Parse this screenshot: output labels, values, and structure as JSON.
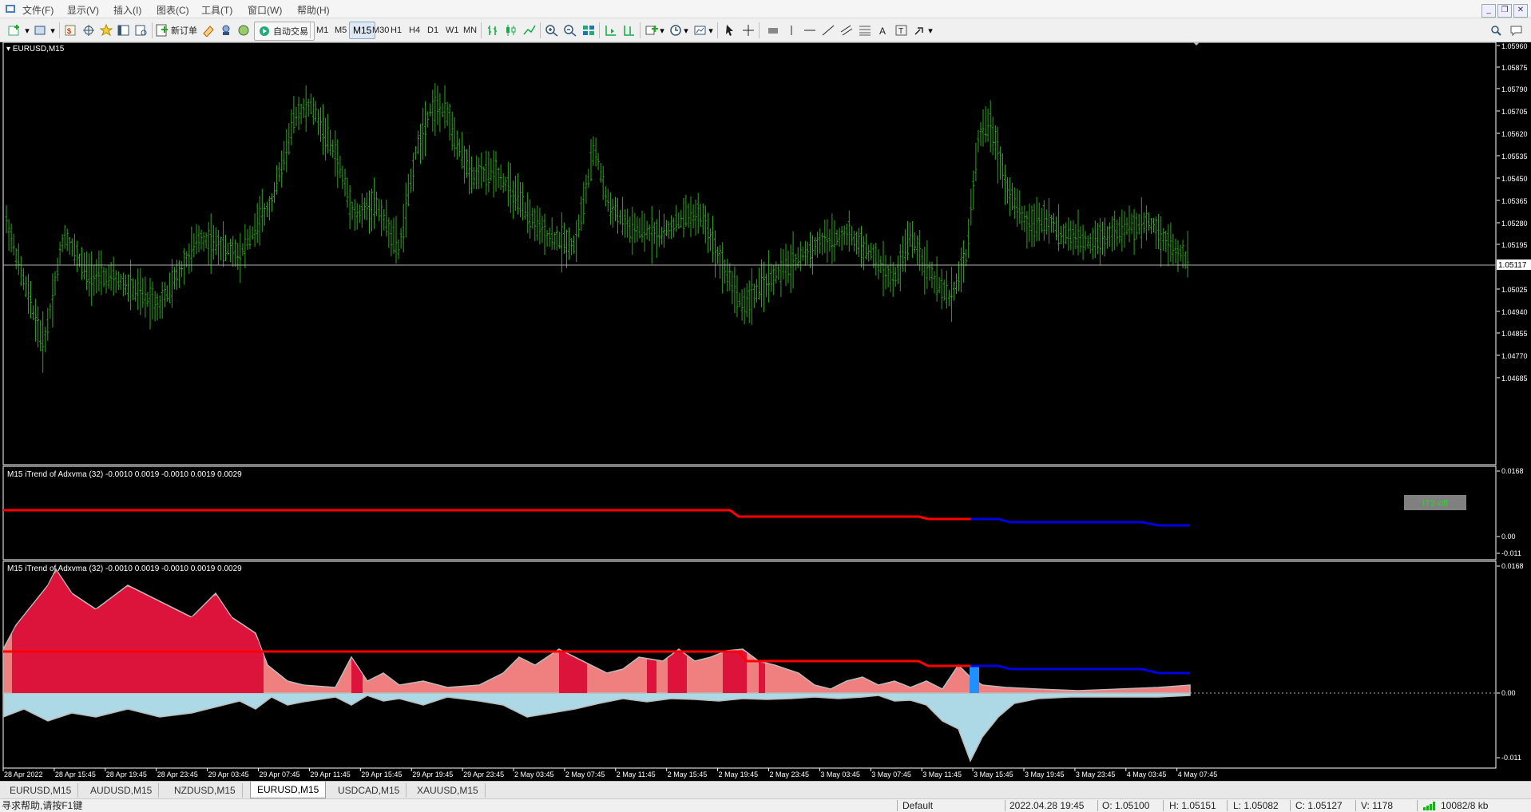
{
  "menu": [
    "文件(F)",
    "显示(V)",
    "插入(I)",
    "图表(C)",
    "工具(T)",
    "窗口(W)",
    "帮助(H)"
  ],
  "toolbar": {
    "new_order": "新订单",
    "auto_trading": "自动交易",
    "timeframes": [
      "M1",
      "M5",
      "M15",
      "M30",
      "H1",
      "H4",
      "D1",
      "W1",
      "MN"
    ],
    "active_timeframe": "M15"
  },
  "chart": {
    "symbol_title": "EURUSD,M15",
    "current_price": "1.05117",
    "price_axis": [
      "1.05960",
      "1.05875",
      "1.05790",
      "1.05705",
      "1.05620",
      "1.05535",
      "1.05450",
      "1.05365",
      "1.05280",
      "1.05195",
      "1.05025",
      "1.04940",
      "1.04855",
      "1.04770",
      "1.04685"
    ],
    "candle_color": "#2fa51e",
    "indicator1": {
      "title": "M15 iTrend of Adxvma (32) -0.0010 0.0019 -0.0010 0.0019 0.0029",
      "axis": [
        "0.0168",
        "0.00",
        "-0.011"
      ],
      "badge": "IT2-off",
      "badge_color": "#22dd22"
    },
    "indicator2": {
      "title": "M15 iTrend of Adxvma (32) -0.0010 0.0019 -0.0010 0.0019 0.0029",
      "axis": [
        "0.0168",
        "0.00",
        "-0.011"
      ]
    },
    "time_axis": [
      "28 Apr 2022",
      "28 Apr 15:45",
      "28 Apr 19:45",
      "28 Apr 23:45",
      "29 Apr 03:45",
      "29 Apr 07:45",
      "29 Apr 11:45",
      "29 Apr 15:45",
      "29 Apr 19:45",
      "29 Apr 23:45",
      "2 May 03:45",
      "2 May 07:45",
      "2 May 11:45",
      "2 May 15:45",
      "2 May 19:45",
      "2 May 23:45",
      "3 May 03:45",
      "3 May 07:45",
      "3 May 11:45",
      "3 May 15:45",
      "3 May 19:45",
      "3 May 23:45",
      "4 May 03:45",
      "4 May 07:45"
    ],
    "colors": {
      "trend_red": "#ff0000",
      "trend_blue": "#0000e0",
      "pos_fill": "#f08080",
      "strong_fill": "#dc143c",
      "neg_fill": "#add8e6",
      "blue_bar": "#1e90ff"
    }
  },
  "tabs": [
    "EURUSD,M15",
    "AUDUSD,M15",
    "NZDUSD,M15",
    "EURUSD,M15",
    "USDCAD,M15",
    "XAUUSD,M15"
  ],
  "active_tab_index": 3,
  "status": {
    "help": "寻求帮助,请按F1键",
    "profile": "Default",
    "datetime": "2022.04.28 19:45",
    "open": "O: 1.05100",
    "high": "H: 1.05151",
    "low": "L: 1.05082",
    "close": "C: 1.05127",
    "volume": "V: 1178",
    "traffic": "10082/8 kb"
  }
}
